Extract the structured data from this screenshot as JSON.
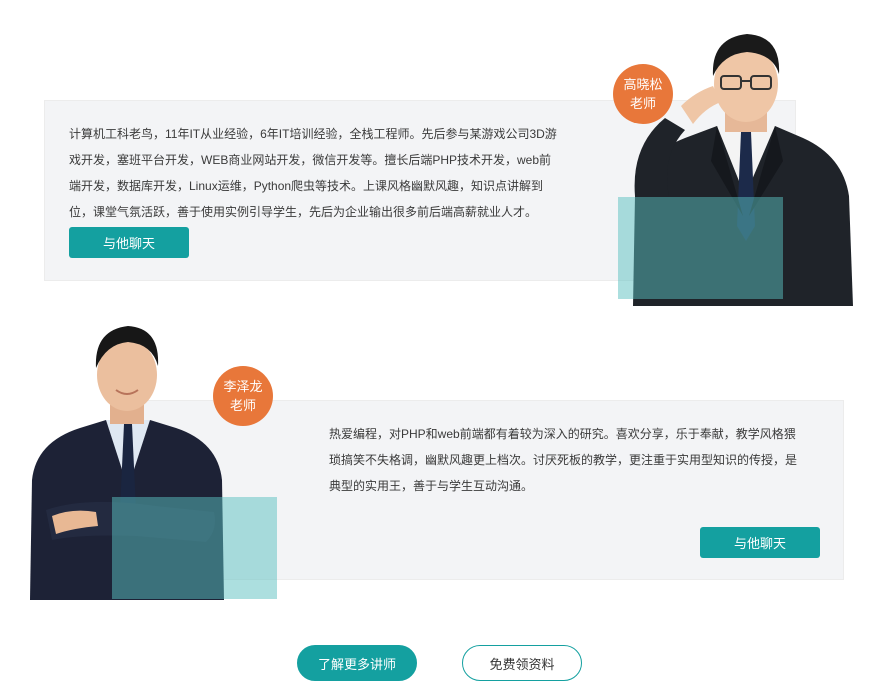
{
  "teachers": [
    {
      "name": "高晓松",
      "title": "老师",
      "bio": "计算机工科老鸟，11年IT从业经验，6年IT培训经验，全栈工程师。先后参与某游戏公司3D游戏开发，塞班平台开发，WEB商业网站开发，微信开发等。擅长后端PHP技术开发，web前端开发，数据库开发，Linux运维，Python爬虫等技术。上课风格幽默风趣，知识点讲解到位，课堂气氛活跃，善于使用实例引导学生，先后为企业输出很多前后端高薪就业人才。",
      "chat_label": "与他聊天"
    },
    {
      "name": "李泽龙",
      "title": "老师",
      "bio": "热爱编程，对PHP和web前端都有着较为深入的研究。喜欢分享，乐于奉献，教学风格猥琐搞笑不失格调，幽默风趣更上档次。讨厌死板的教学，更注重于实用型知识的传授，是典型的实用王，善于与学生互动沟通。",
      "chat_label": "与他聊天"
    }
  ],
  "actions": {
    "more_teachers": "了解更多讲师",
    "free_materials": "免费领资料"
  },
  "colors": {
    "accent": "#14a0a0",
    "badge": "#e8773a",
    "card_bg": "#f3f4f6"
  }
}
